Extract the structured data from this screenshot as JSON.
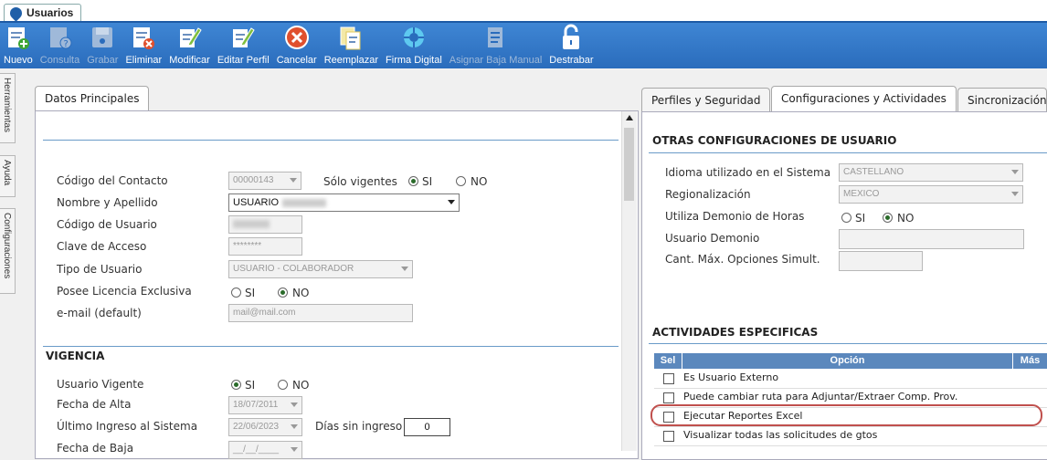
{
  "window_tab": {
    "title": "Usuarios"
  },
  "toolbar": [
    {
      "label": "Nuevo",
      "icon": "new-user-icon",
      "enabled": true
    },
    {
      "label": "Consulta",
      "icon": "consult-icon",
      "enabled": false
    },
    {
      "label": "Grabar",
      "icon": "save-icon",
      "enabled": false
    },
    {
      "label": "Eliminar",
      "icon": "delete-icon",
      "enabled": true
    },
    {
      "label": "Modificar",
      "icon": "edit-icon",
      "enabled": true
    },
    {
      "label": "Editar Perfil",
      "icon": "edit-profile-icon",
      "enabled": true
    },
    {
      "label": "Cancelar",
      "icon": "cancel-icon",
      "enabled": true
    },
    {
      "label": "Reemplazar",
      "icon": "replace-icon",
      "enabled": true
    },
    {
      "label": "Firma Digital",
      "icon": "digital-signature-icon",
      "enabled": true
    },
    {
      "label": "Asignar Baja Manual",
      "icon": "manual-unassign-icon",
      "enabled": false
    },
    {
      "label": "Destrabar",
      "icon": "unlock-icon",
      "enabled": true
    }
  ],
  "side_tabs": [
    "Herramientas",
    "Ayuda",
    "Configuraciones"
  ],
  "left_panel": {
    "tab": "Datos Principales",
    "fields": {
      "codigo_contacto": {
        "label": "Código del Contacto",
        "value": "00000143"
      },
      "solo_vigentes": {
        "label": "Sólo vigentes",
        "si": "SI",
        "no": "NO"
      },
      "nombre": {
        "label": "Nombre y Apellido",
        "value": "USUARIO"
      },
      "codigo_usuario": {
        "label": "Código de Usuario"
      },
      "clave": {
        "label": "Clave de Acceso",
        "value": "********"
      },
      "tipo_usuario": {
        "label": "Tipo de Usuario",
        "value": "USUARIO - COLABORADOR"
      },
      "licencia": {
        "label": "Posee Licencia Exclusiva",
        "si": "SI",
        "no": "NO"
      },
      "email": {
        "label": "e-mail (default)",
        "value": "mail@mail.com"
      }
    },
    "vigencia": {
      "heading": "VIGENCIA",
      "usuario_vigente": {
        "label": "Usuario Vigente",
        "si": "SI",
        "no": "NO"
      },
      "fecha_alta": {
        "label": "Fecha de Alta",
        "value": "18/07/2011"
      },
      "ultimo_ingreso": {
        "label": "Último Ingreso al Sistema",
        "value": "22/06/2023"
      },
      "dias_sin_ingreso": {
        "label": "Días sin ingreso",
        "value": "0"
      },
      "fecha_baja": {
        "label": "Fecha de Baja",
        "value": "__/__/____"
      }
    }
  },
  "right_panel": {
    "tabs": [
      "Perfiles y Seguridad",
      "Configuraciones y Actividades",
      "Sincronización"
    ],
    "otras": {
      "heading": "OTRAS CONFIGURACIONES DE USUARIO",
      "idioma": {
        "label": "Idioma utilizado en el Sistema",
        "value": "CASTELLANO"
      },
      "regionalizacion": {
        "label": "Regionalización",
        "value": "MEXICO"
      },
      "demonio_horas": {
        "label": "Utiliza Demonio de Horas",
        "si": "SI",
        "no": "NO"
      },
      "usuario_demonio": {
        "label": "Usuario Demonio"
      },
      "cant_max": {
        "label": "Cant. Máx. Opciones Simult."
      }
    },
    "actividades": {
      "heading": "ACTIVIDADES ESPECIFICAS",
      "columns": [
        "Sel",
        "Opción",
        "Más"
      ],
      "rows": [
        "Es Usuario Externo",
        "Puede cambiar ruta para Adjuntar/Extraer Comp. Prov.",
        "Ejecutar Reportes Excel",
        "Visualizar todas las solicitudes de gtos"
      ],
      "highlight_color": "#c0504d"
    }
  }
}
